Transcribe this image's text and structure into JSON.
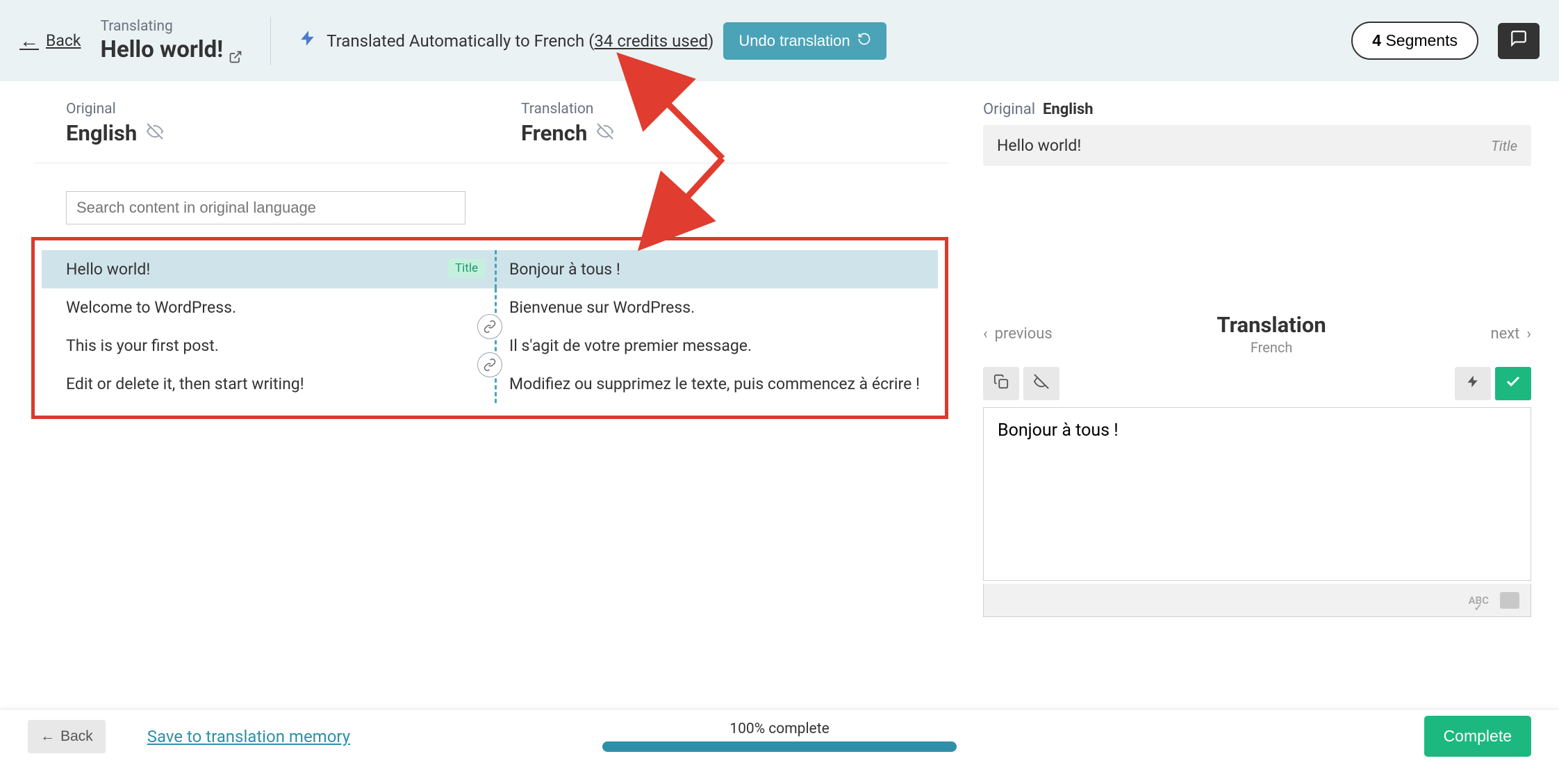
{
  "header": {
    "back_label": "Back",
    "title_label": "Translating",
    "title_text": "Hello world!",
    "status_prefix": "Translated Automatically to French (",
    "status_credits": "34 credits used",
    "status_suffix": ")",
    "undo_label": "Undo translation",
    "segments_count": "4",
    "segments_label": "Segments"
  },
  "langs": {
    "original_label": "Original",
    "original_name": "English",
    "translation_label": "Translation",
    "translation_name": "French"
  },
  "search": {
    "placeholder": "Search content in original language"
  },
  "segments": [
    {
      "orig": "Hello world!",
      "trans": "Bonjour à tous !",
      "badge": "Title",
      "active": true,
      "link_after": false
    },
    {
      "orig": "Welcome to WordPress.",
      "trans": "Bienvenue sur WordPress.",
      "badge": null,
      "active": false,
      "link_after": true
    },
    {
      "orig": "This is your first post.",
      "trans": "Il s'agit de votre premier message.",
      "badge": null,
      "active": false,
      "link_after": true
    },
    {
      "orig": "Edit or delete it, then start writing!",
      "trans": "Modifiez ou supprimez le texte, puis commencez à écrire !",
      "badge": null,
      "active": false,
      "link_after": false
    }
  ],
  "right": {
    "original_label": "Original",
    "original_lang": "English",
    "original_text": "Hello world!",
    "original_badge": "Title",
    "prev_label": "previous",
    "next_label": "next",
    "translation_title": "Translation",
    "translation_lang": "French",
    "translation_value": "Bonjour à tous !"
  },
  "footer": {
    "back_label": "Back",
    "save_mem_label": "Save to translation memory",
    "progress_label": "100% complete",
    "complete_label": "Complete"
  }
}
